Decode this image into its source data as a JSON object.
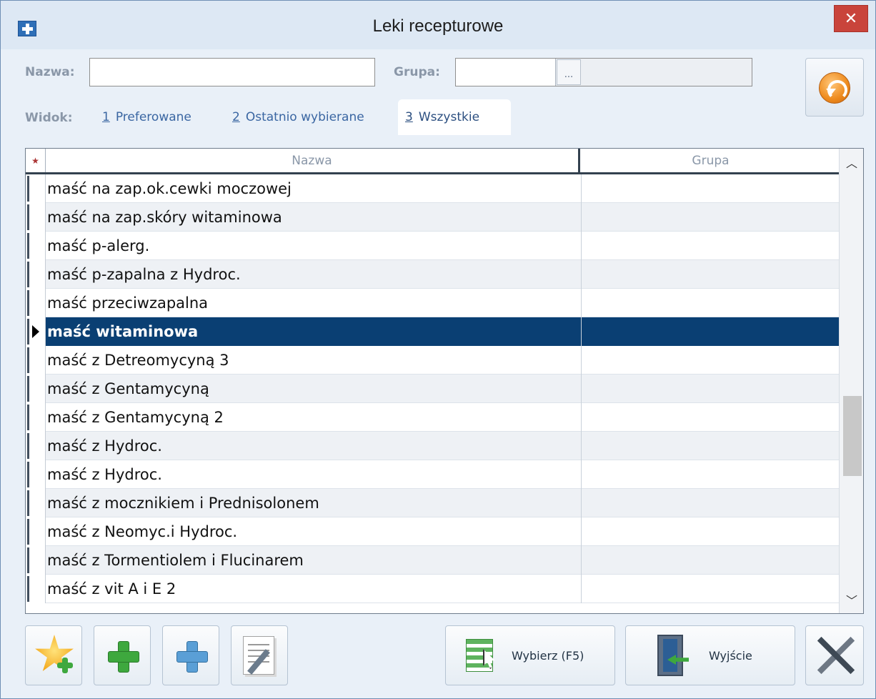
{
  "window": {
    "title": "Leki recepturowe",
    "close_glyph": "✕"
  },
  "filters": {
    "name_label": "Nazwa:",
    "name_value": "",
    "group_label": "Grupa:",
    "group_value": "",
    "group_browse": "...",
    "view_label": "Widok:"
  },
  "tabs": [
    {
      "key": "1",
      "label": "Preferowane",
      "active": false
    },
    {
      "key": "2",
      "label": "Ostatnio wybierane",
      "active": false
    },
    {
      "key": "3",
      "label": "Wszystkie",
      "active": true
    }
  ],
  "grid": {
    "columns": {
      "star": "★",
      "name": "Nazwa",
      "group": "Grupa"
    },
    "rows": [
      {
        "name": "maść na zap.ok.cewki moczowej",
        "group": ""
      },
      {
        "name": "maść na zap.skóry witaminowa",
        "group": ""
      },
      {
        "name": "maść p-alerg.",
        "group": ""
      },
      {
        "name": "maść p-zapalna z Hydroc.",
        "group": ""
      },
      {
        "name": "maść przeciwzapalna",
        "group": ""
      },
      {
        "name": "maść witaminowa",
        "group": "",
        "selected": true
      },
      {
        "name": "maść z Detreomycyną 3",
        "group": ""
      },
      {
        "name": "maść z Gentamycyną",
        "group": ""
      },
      {
        "name": "maść z Gentamycyną 2",
        "group": ""
      },
      {
        "name": "maść z Hydroc.",
        "group": ""
      },
      {
        "name": "maść z Hydroc.",
        "group": ""
      },
      {
        "name": "maść z mocznikiem i Prednisolonem",
        "group": ""
      },
      {
        "name": "maść z Neomyc.i Hydroc.",
        "group": ""
      },
      {
        "name": "maść z Tormentiolem i Flucinarem",
        "group": ""
      },
      {
        "name": "maść z vit A i E 2",
        "group": ""
      }
    ]
  },
  "footer": {
    "select_label": "Wybierz (F5)",
    "exit_label": "Wyjście"
  },
  "colors": {
    "selection": "#0a3f73",
    "close": "#c9443b"
  }
}
